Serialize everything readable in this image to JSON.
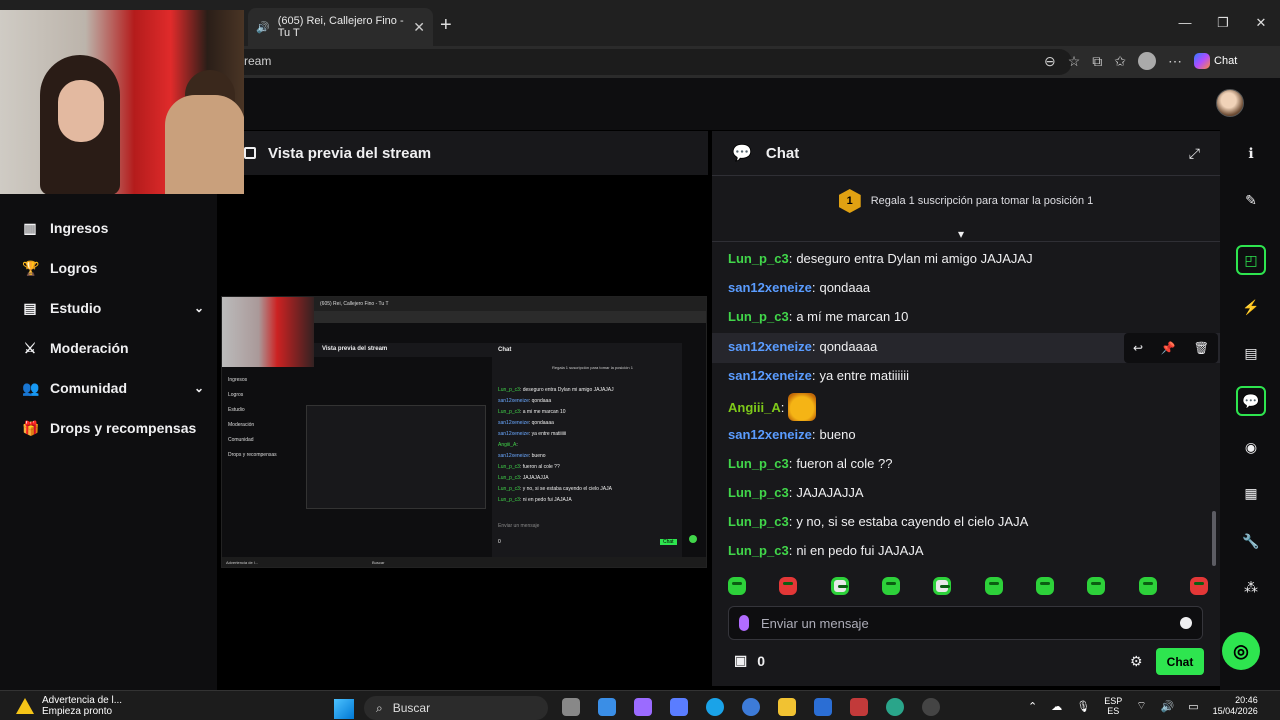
{
  "browser": {
    "tab_title": "(605) Rei, Callejero Fino - Tu T",
    "url_fragment": "ream",
    "copilot_label": "Chat",
    "window_controls": [
      "—",
      "❐",
      "✕"
    ]
  },
  "sidebar": {
    "items": [
      {
        "label": "Ingresos",
        "icon": "bar-chart-icon",
        "glyph": "▥"
      },
      {
        "label": "Logros",
        "icon": "trophy-icon",
        "glyph": "🏆"
      },
      {
        "label": "Estudio",
        "icon": "film-icon",
        "glyph": "▤",
        "expandable": true
      },
      {
        "label": "Moderación",
        "icon": "sword-icon",
        "glyph": "⚔"
      },
      {
        "label": "Comunidad",
        "icon": "people-icon",
        "glyph": "👥",
        "expandable": true
      },
      {
        "label": "Drops y recompensas",
        "icon": "gift-icon",
        "glyph": "🎁"
      }
    ]
  },
  "preview": {
    "title": "Vista previa del stream"
  },
  "nested_preview": {
    "tab_title": "(605) Rei, Callejero Fino - Tu T",
    "sidebar": [
      "Ingresos",
      "Logros",
      "Estudio",
      "Moderación",
      "Comunidad",
      "Drops y recompensas"
    ],
    "preview_title": "Vista previa del stream",
    "chat_title": "Chat",
    "banner": "Regala 1 suscripción para tomar la posición 1",
    "lines": [
      {
        "user": "Lun_p_c3",
        "text": "deseguro entra Dylan mi amigo JAJAJAJ",
        "color": "green"
      },
      {
        "user": "san12xeneize",
        "text": "qondaaa",
        "color": "blue"
      },
      {
        "user": "Lun_p_c3",
        "text": "a mi me marcan 10",
        "color": "green"
      },
      {
        "user": "san12xeneize",
        "text": "qondaaaa",
        "color": "blue"
      },
      {
        "user": "san12xeneize",
        "text": "ya entre matiiiiii",
        "color": "blue"
      },
      {
        "user": "Angiii_A",
        "text": "",
        "color": "green"
      },
      {
        "user": "san12xeneize",
        "text": "bueno",
        "color": "blue"
      },
      {
        "user": "Lun_p_c3",
        "text": "fueron al cole ??",
        "color": "green"
      },
      {
        "user": "Lun_p_c3",
        "text": "JAJAJAJJA",
        "color": "green"
      },
      {
        "user": "Lun_p_c3",
        "text": "y no, si se estaba cayendo el cielo JAJA",
        "color": "green"
      },
      {
        "user": "Lun_p_c3",
        "text": "ni en pedo fui JAJAJA",
        "color": "green"
      }
    ],
    "input_placeholder": "Enviar un mensaje",
    "bits": "0",
    "chat_button": "Chat",
    "taskbar_warn": "Advertencia de l...",
    "taskbar_search": "Buscar"
  },
  "chat": {
    "title": "Chat",
    "leaderboard": {
      "position": "1",
      "text": "Regala 1 suscripción para tomar la posición 1"
    },
    "messages": [
      {
        "user": "Lun_p_c3",
        "text": "deseguro entra Dylan mi amigo JAJAJAJ",
        "color": "green"
      },
      {
        "user": "san12xeneize",
        "text": "qondaaa",
        "color": "blue"
      },
      {
        "user": "Lun_p_c3",
        "text": "a mí me marcan 10",
        "color": "green"
      },
      {
        "user": "san12xeneize",
        "text": "qondaaaa",
        "color": "blue",
        "hovered": true
      },
      {
        "user": "san12xeneize",
        "text": "ya entre matiiiiii",
        "color": "blue"
      },
      {
        "user": "Angiii_A",
        "text": "",
        "color": "lime",
        "emote": "dancing-emote"
      },
      {
        "user": "san12xeneize",
        "text": "bueno",
        "color": "blue"
      },
      {
        "user": "Lun_p_c3",
        "text": "fueron al cole ??",
        "color": "green"
      },
      {
        "user": "Lun_p_c3",
        "text": "JAJAJAJJA",
        "color": "green"
      },
      {
        "user": "Lun_p_c3",
        "text": "y no, si se estaba cayendo el cielo JAJA",
        "color": "green"
      },
      {
        "user": "Lun_p_c3",
        "text": "ni en pedo fui JAJAJA",
        "color": "green"
      }
    ],
    "message_actions": [
      "reply-icon",
      "pin-icon",
      "delete-icon"
    ],
    "input_placeholder": "Enviar un mensaje",
    "bits_count": "0",
    "send_label": "Chat",
    "quick_emotes": [
      "green",
      "red",
      "white",
      "green",
      "white",
      "green",
      "green",
      "green",
      "green",
      "red"
    ]
  },
  "rail": {
    "buttons": [
      {
        "icon": "info-icon",
        "glyph": "ℹ"
      },
      {
        "icon": "pencil-icon",
        "glyph": "✎"
      },
      {
        "icon": "screen-capture-icon",
        "glyph": "◰",
        "active": true
      },
      {
        "icon": "lightning-icon",
        "glyph": "⚡"
      },
      {
        "icon": "notes-icon",
        "glyph": "▤"
      },
      {
        "icon": "chat-bubble-icon",
        "glyph": "💬",
        "active": true
      },
      {
        "icon": "broadcast-icon",
        "glyph": "◉"
      },
      {
        "icon": "panels-icon",
        "glyph": "▦"
      },
      {
        "icon": "wrench-icon",
        "glyph": "🔧"
      },
      {
        "icon": "network-icon",
        "glyph": "⁂"
      }
    ]
  },
  "taskbar": {
    "warning_line1": "Advertencia de l...",
    "warning_line2": "Empieza pronto",
    "search_placeholder": "Buscar",
    "lang_line1": "ESP",
    "lang_line2": "ES",
    "time": "20:46",
    "date": "15/04/2026"
  },
  "colors": {
    "twitch_bg": "#0e0e10",
    "panel_bg": "#18181b",
    "accent_green": "#2ee54f",
    "user_green": "#41d64a",
    "user_blue": "#5a9cff",
    "leader_gold": "#e0a112"
  }
}
